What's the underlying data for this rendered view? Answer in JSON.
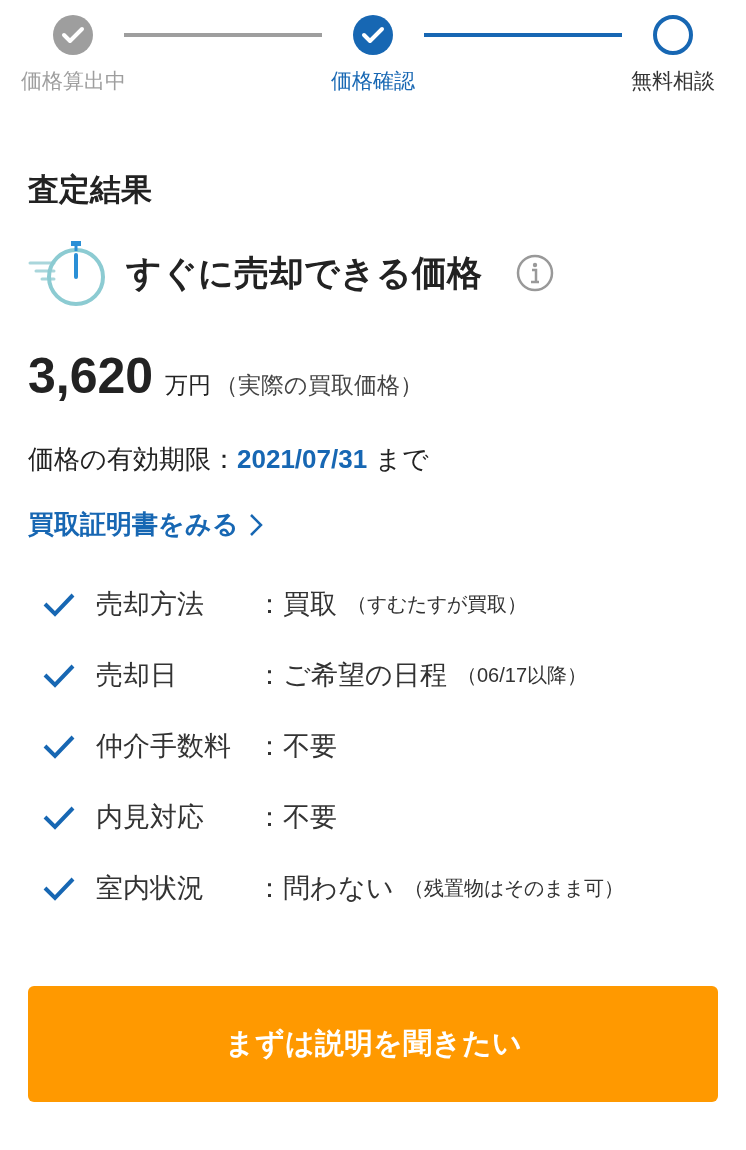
{
  "steps": [
    {
      "label": "価格算出中",
      "completed": true,
      "selected": false
    },
    {
      "label": "価格確認",
      "completed": true,
      "selected": true
    },
    {
      "label": "無料相談",
      "completed": false,
      "selected": false
    }
  ],
  "heading": "査定結果",
  "price_type": {
    "title": "すぐに売却できる価格"
  },
  "price": {
    "amount": "3,620",
    "unit": "万円",
    "note": "（実際の買取価格）"
  },
  "expiry": {
    "label": "価格の有効期限：",
    "date": "2021/07/31",
    "suffix": "まで"
  },
  "certificate_link": "買取証明書をみる",
  "conditions": [
    {
      "label": "売却方法",
      "separator": "：",
      "value": "買取",
      "note": "（すむたすが買取）"
    },
    {
      "label": "売却日",
      "separator": "：",
      "value": "ご希望の日程",
      "note": "（06/17以降）"
    },
    {
      "label": "仲介手数料",
      "separator": "：",
      "value": "不要"
    },
    {
      "label": "内見対応",
      "separator": "：",
      "value": "不要"
    },
    {
      "label": "室内状況",
      "separator": "：",
      "value": "問わない",
      "note": "（残置物はそのまま可）"
    }
  ],
  "cta_button": "まずは説明を聞きたい"
}
